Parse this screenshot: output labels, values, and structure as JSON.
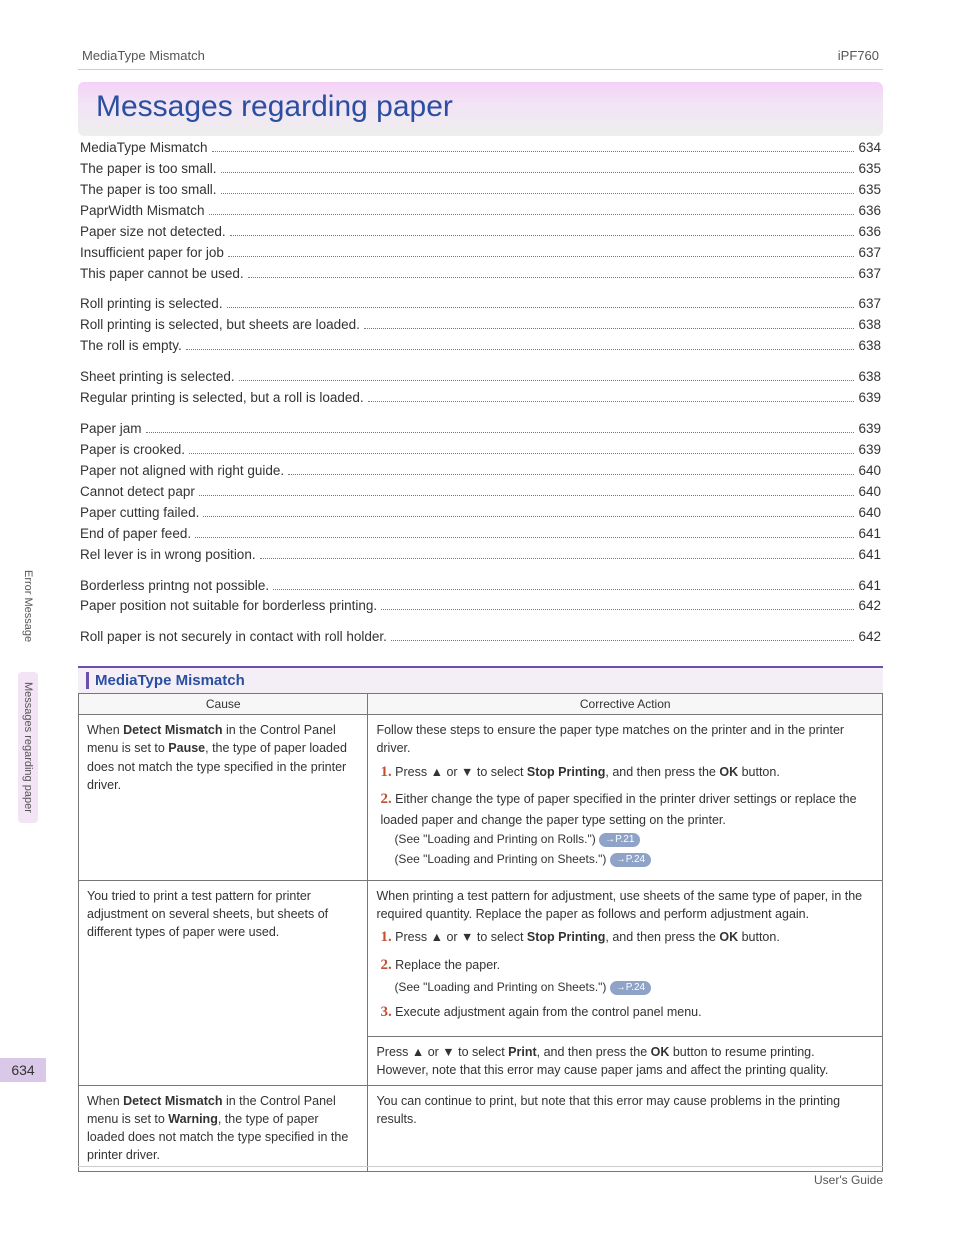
{
  "header": {
    "left": "MediaType Mismatch",
    "right": "iPF760"
  },
  "title": "Messages regarding paper",
  "side_tabs": {
    "top": "Error Message",
    "active": "Messages regarding paper"
  },
  "page_number": "634",
  "footer": "User's Guide",
  "toc_groups": [
    [
      {
        "label": "MediaType Mismatch",
        "page": "634"
      },
      {
        "label": "The paper is too small.",
        "page": "635"
      },
      {
        "label": "The paper is too small.",
        "page": "635"
      },
      {
        "label": "PaprWidth Mismatch",
        "page": "636"
      },
      {
        "label": "Paper size not detected.",
        "page": "636"
      },
      {
        "label": "Insufficient paper for job",
        "page": "637"
      },
      {
        "label": "This paper cannot be used.",
        "page": "637"
      }
    ],
    [
      {
        "label": "Roll printing is selected.",
        "page": "637"
      },
      {
        "label": "Roll printing is selected, but sheets are loaded.",
        "page": "638"
      },
      {
        "label": "The roll is empty.",
        "page": "638"
      }
    ],
    [
      {
        "label": "Sheet printing is selected.",
        "page": "638"
      },
      {
        "label": "Regular printing is selected, but a roll is loaded.",
        "page": "639"
      }
    ],
    [
      {
        "label": "Paper jam",
        "page": "639"
      },
      {
        "label": "Paper is crooked.",
        "page": "639"
      },
      {
        "label": "Paper not aligned with right guide.",
        "page": "640"
      },
      {
        "label": "Cannot detect papr",
        "page": "640"
      },
      {
        "label": "Paper cutting failed.",
        "page": "640"
      },
      {
        "label": "End of paper feed.",
        "page": "641"
      },
      {
        "label": "Rel lever is in wrong position.",
        "page": "641"
      }
    ],
    [
      {
        "label": "Borderless printng not possible.",
        "page": "641"
      },
      {
        "label": "Paper position not suitable for borderless printing.",
        "page": "642"
      }
    ],
    [
      {
        "label": "Roll paper is not securely in contact with roll holder.",
        "page": "642"
      }
    ]
  ],
  "section": {
    "title": "MediaType Mismatch",
    "table": {
      "headers": {
        "cause": "Cause",
        "action": "Corrective Action"
      },
      "row1": {
        "cause_parts": [
          "When ",
          "Detect Mismatch",
          " in the Control Panel menu is set to ",
          "Pause",
          ", the type of paper loaded does not match the type specified in the printer driver."
        ],
        "action_intro": "Follow these steps to ensure the paper type matches on the printer and in the printer driver.",
        "step1_parts": [
          "Press ▲ or ▼ to select ",
          "Stop Printing",
          ", and then press the ",
          "OK",
          " button."
        ],
        "step2_text": "Either change the type of paper specified in the printer driver settings or replace the loaded paper and change the paper type setting on the printer.",
        "see1": "(See \"Loading and Printing on Rolls.\")",
        "pref1": "→P.21",
        "see2": "(See \"Loading and Printing on Sheets.\")",
        "pref2": "→P.24"
      },
      "row2a": {
        "cause": "You tried to print a test pattern for printer adjustment on several sheets, but sheets of different types of paper were used.",
        "action_intro": "When printing a test pattern for adjustment, use sheets of the same type of paper, in the required quantity. Replace the paper as follows and perform adjustment again.",
        "step1_parts": [
          "Press ▲ or ▼ to select ",
          "Stop Printing",
          ", and then press the ",
          "OK",
          " button."
        ],
        "step2_text": "Replace the paper.",
        "see1": "(See \"Loading and Printing on Sheets.\")",
        "pref1": "→P.24",
        "step3_text": "Execute adjustment again from the control panel menu."
      },
      "row2b": {
        "line1_parts": [
          "Press ▲ or ▼ to select ",
          "Print",
          ", and then press the ",
          "OK",
          " button to resume printing."
        ],
        "line2": "However, note that this error may cause paper jams and affect the printing quality."
      },
      "row3": {
        "cause_parts": [
          "When ",
          "Detect Mismatch",
          " in the Control Panel menu is set to ",
          "Warning",
          ", the type of paper loaded does not match the type specified in the printer driver."
        ],
        "action": "You can continue to print, but note that this error may cause problems in the printing results."
      }
    }
  }
}
